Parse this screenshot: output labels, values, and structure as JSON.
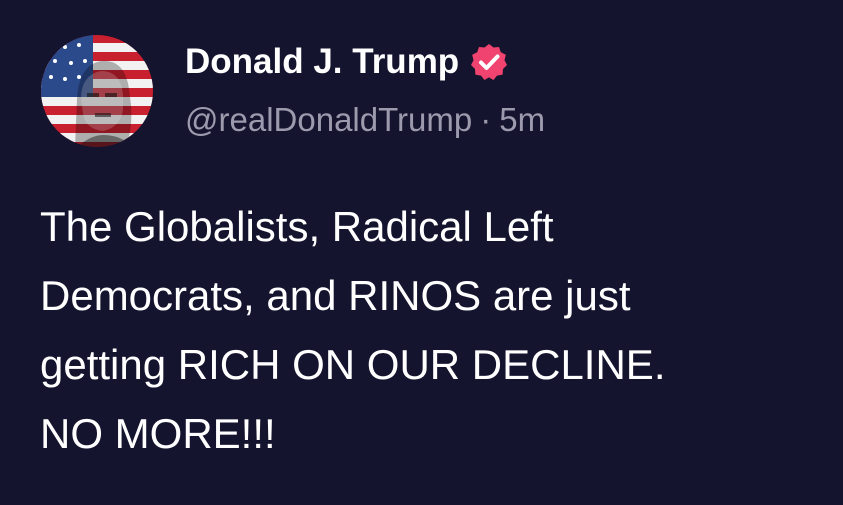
{
  "post": {
    "author": {
      "display_name": "Donald J. Trump",
      "handle": "@realDonaldTrump",
      "avatar_icon": "flag-portrait-avatar",
      "verified_icon": "verified-badge-icon",
      "verified_color": "#f0436f"
    },
    "separator": "·",
    "timestamp": "5m",
    "text": "The Globalists, Radical Left\nDemocrats, and RINOS are just\ngetting RICH ON OUR DECLINE.\nNO MORE!!!"
  },
  "colors": {
    "background": "#15142f",
    "text": "#ffffff",
    "meta": "#9c9aad"
  }
}
